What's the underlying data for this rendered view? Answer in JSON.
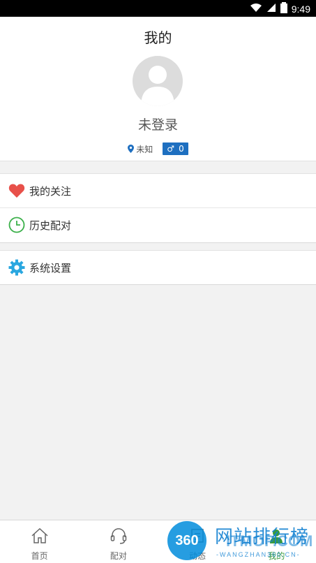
{
  "status_bar": {
    "time": "9:49"
  },
  "header": {
    "title": "我的"
  },
  "profile": {
    "username": "未登录",
    "location": "未知",
    "gender_symbol": "♂",
    "count": "0"
  },
  "menu": {
    "group1": [
      {
        "label": "我的关注",
        "icon": "heart-icon"
      },
      {
        "label": "历史配对",
        "icon": "clock-icon"
      }
    ],
    "group2": [
      {
        "label": "系统设置",
        "icon": "gear-icon"
      }
    ]
  },
  "bottom_nav": {
    "tabs": [
      {
        "label": "首页",
        "icon": "home-icon"
      },
      {
        "label": "配对",
        "icon": "headset-icon"
      },
      {
        "label": "动态",
        "icon": "feed-icon"
      },
      {
        "label": "我的",
        "icon": "user-icon",
        "active": true
      }
    ]
  },
  "watermark": {
    "circle": "360",
    "cn": "网站排行榜",
    "en": "ITMOP.COM",
    "sub": "-WANGZHAN360.CN-"
  },
  "colors": {
    "accent_blue": "#1e6fc0",
    "heart_red": "#e8504a",
    "clock_green": "#3bb04a",
    "gear_blue": "#2aa7e0",
    "active_green": "#3a9b3a"
  }
}
